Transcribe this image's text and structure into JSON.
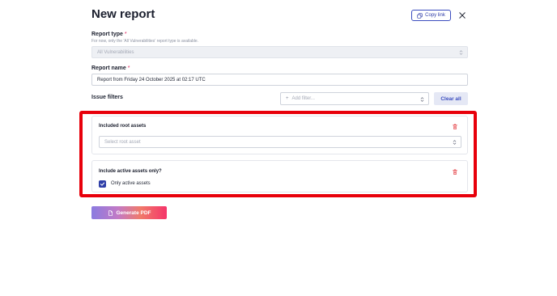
{
  "header": {
    "title": "New report",
    "copy_link_label": "Copy link"
  },
  "report_type": {
    "label": "Report type",
    "required_marker": "*",
    "hint": "For now, only the 'All Vulnerabilities' report type is available.",
    "value": "All Vulnerabilities"
  },
  "report_name": {
    "label": "Report name",
    "required_marker": "*",
    "value": "Report from Friday 24 October 2025 at 02:17 UTC"
  },
  "issue_filters": {
    "title": "Issue filters",
    "add_filter_placeholder": "Add filter...",
    "add_filter_icon": "+",
    "clear_all_label": "Clear all"
  },
  "filters": [
    {
      "title": "Included root assets",
      "placeholder": "Select root asset"
    },
    {
      "title": "Include active assets only?",
      "checkbox_label": "Only active assets",
      "checked": true
    }
  ],
  "actions": {
    "generate_label": "Generate PDF"
  },
  "colors": {
    "accent": "#2f3fa8",
    "highlight": "#e8000b",
    "delete": "#e5484d",
    "gradient_start": "#8b7be0",
    "gradient_end": "#f5356a"
  }
}
